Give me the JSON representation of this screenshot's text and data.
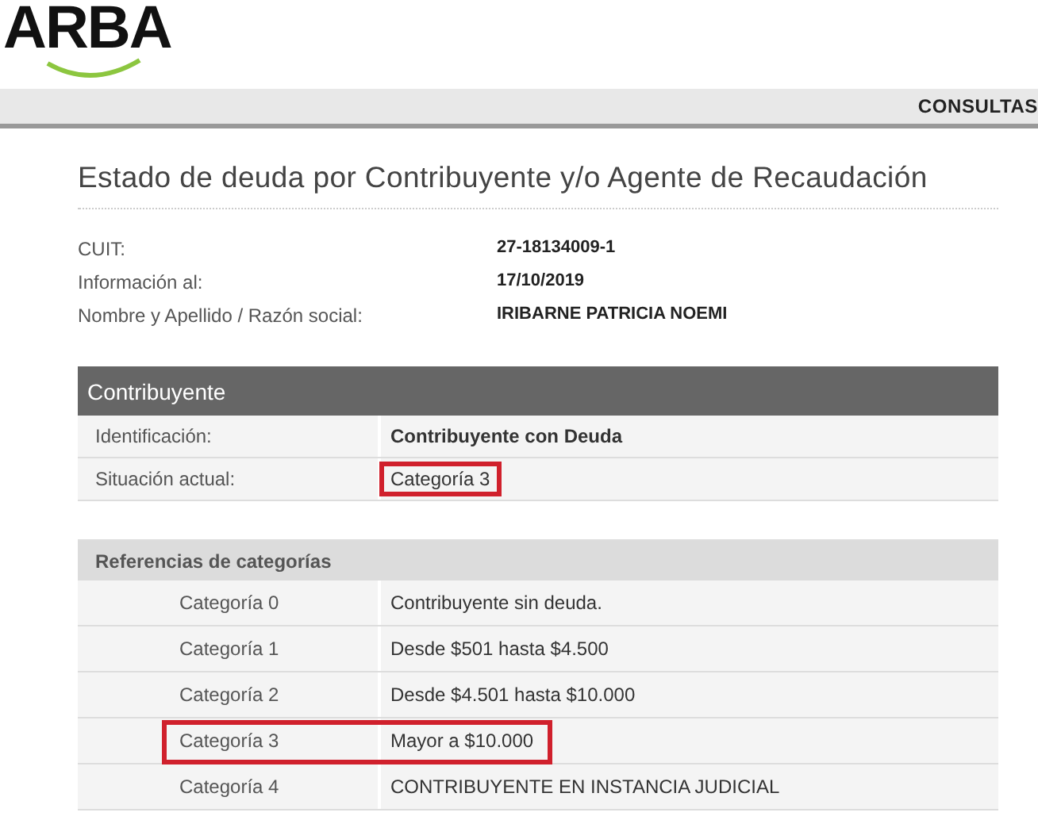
{
  "logo": {
    "text": "ARBA"
  },
  "nav": {
    "items": [
      "CONSULTAS"
    ]
  },
  "page_title": "Estado de deuda por Contribuyente y/o Agente de Recaudación",
  "info": [
    {
      "label": "CUIT:",
      "value": "27-18134009-1"
    },
    {
      "label": "Información al:",
      "value": "17/10/2019"
    },
    {
      "label": "Nombre y Apellido / Razón social:",
      "value": "IRIBARNE PATRICIA NOEMI"
    }
  ],
  "table": {
    "title": "Contribuyente",
    "rows": [
      {
        "label": "Identificación:",
        "value": "Contribuyente con Deuda",
        "bold": true,
        "highlighted": false
      },
      {
        "label": "Situación actual:",
        "value": "Categoría 3",
        "bold": false,
        "highlighted": true
      }
    ],
    "section": "Referencias de categorías",
    "categories": [
      {
        "label": "Categoría 0",
        "value": "Contribuyente sin deuda.",
        "highlighted": false
      },
      {
        "label": "Categoría 1",
        "value": "Desde $501 hasta $4.500",
        "highlighted": false
      },
      {
        "label": "Categoría 2",
        "value": "Desde $4.501 hasta $10.000",
        "highlighted": false
      },
      {
        "label": "Categoría 3",
        "value": "Mayor a $10.000",
        "highlighted": true
      },
      {
        "label": "Categoría 4",
        "value": "CONTRIBUYENTE EN INSTANCIA JUDICIAL",
        "highlighted": false
      }
    ]
  }
}
